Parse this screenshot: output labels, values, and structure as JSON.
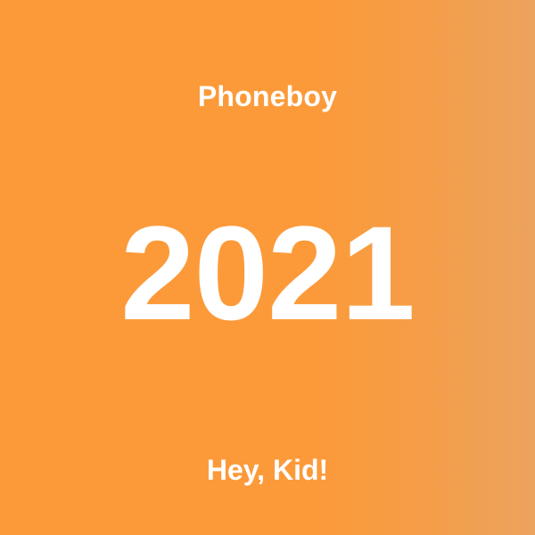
{
  "cover": {
    "artist": "Phoneboy",
    "year": "2021",
    "title": "Hey, Kid!"
  },
  "colors": {
    "background_primary": "#FC9A3A",
    "background_fade": "#ECA35E",
    "text": "#FFFFFF"
  }
}
